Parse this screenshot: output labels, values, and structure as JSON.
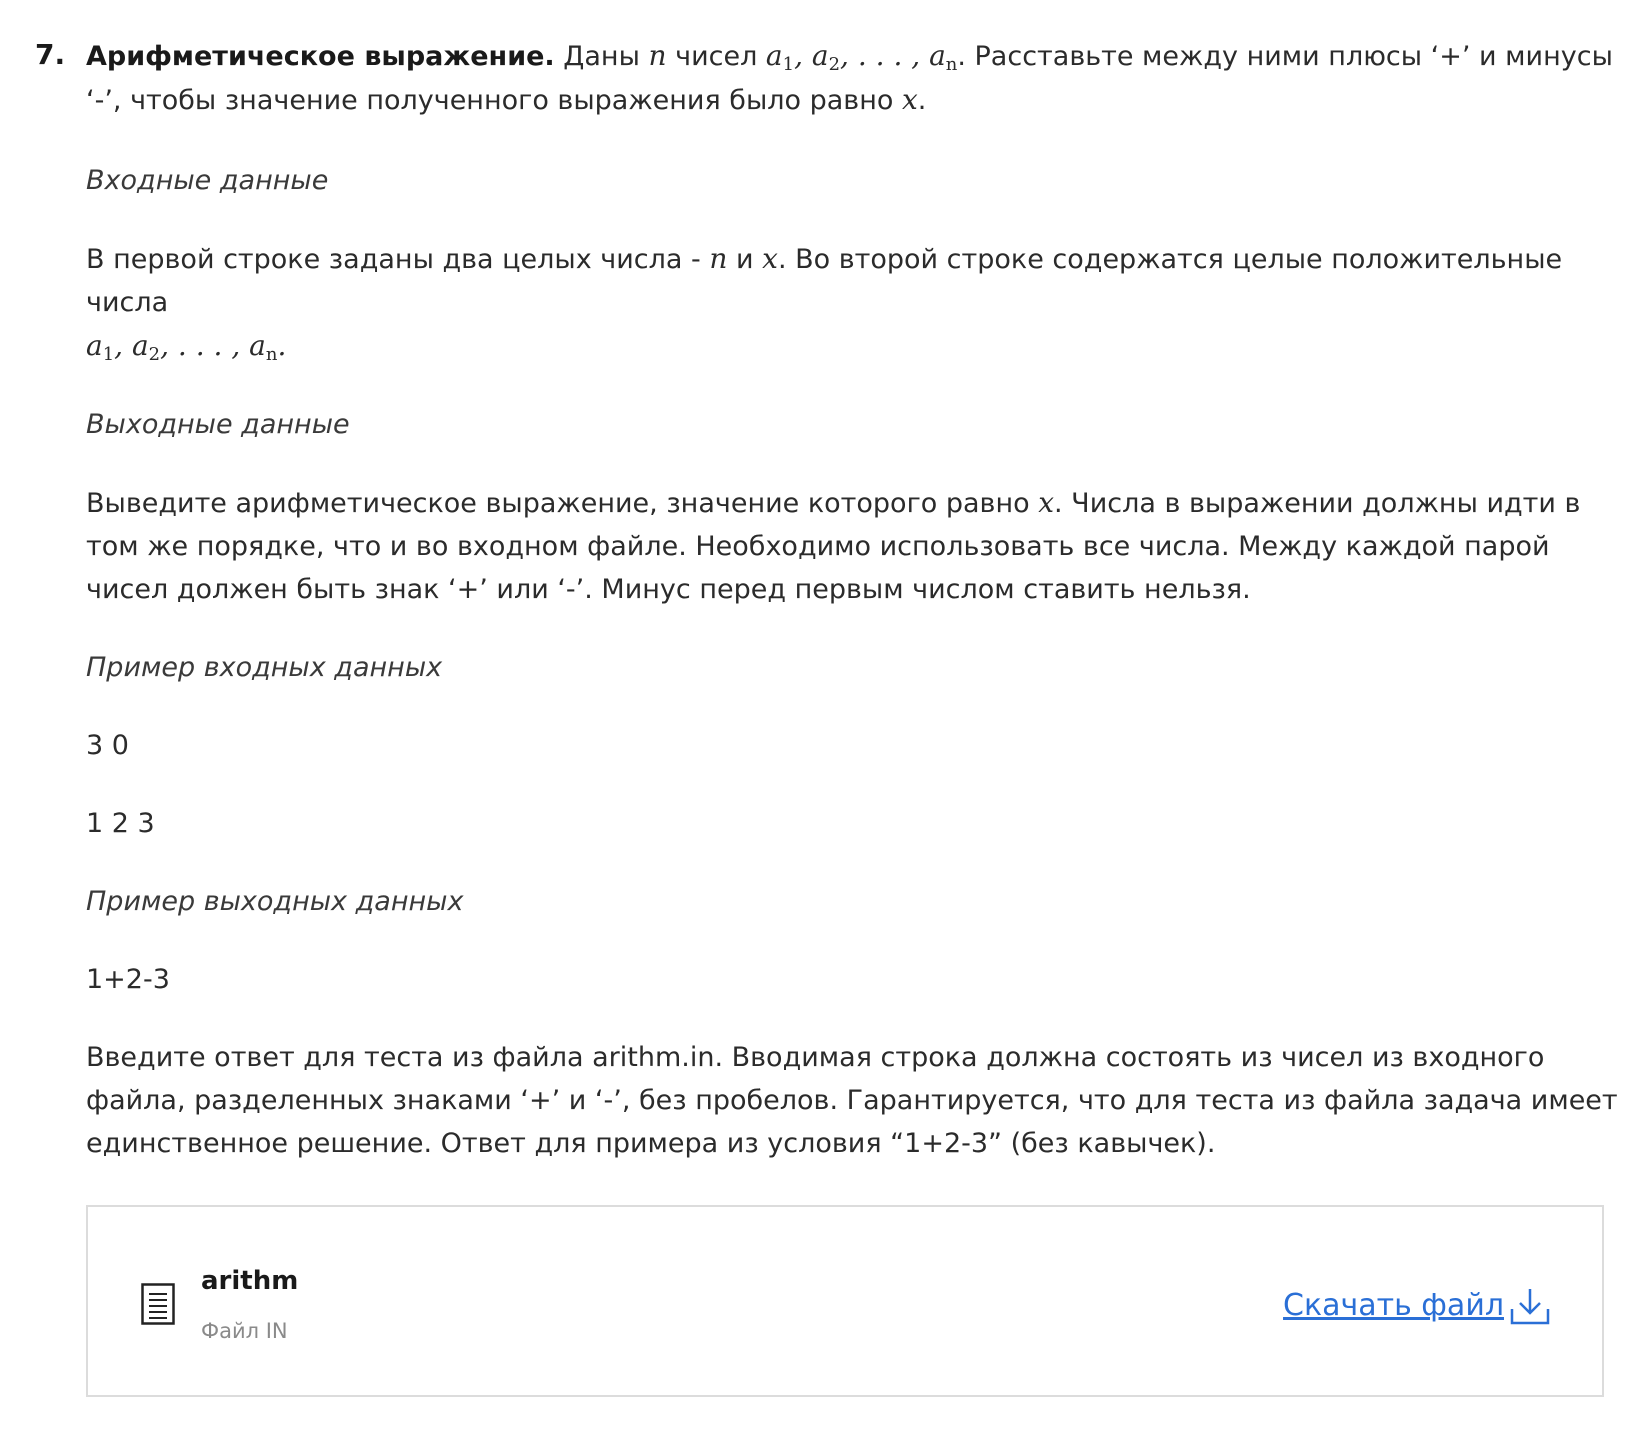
{
  "problem": {
    "number": "7.",
    "title": "Арифметическое выражение.",
    "statement": {
      "t1": " Даны ",
      "n": "n",
      "t2": " чисел ",
      "a": "a",
      "sub1": "1",
      "sub2": "2",
      "ellipsis": ", . . . , ",
      "subn": "n",
      "t3": ". Расставьте между ними плюсы ‘+’ и минусы ‘-’, чтобы значение полученного выражения было равно ",
      "x": "x",
      "t4": "."
    },
    "input_heading": "Входные данные",
    "input_text": {
      "t1": "В первой строке заданы два целых числа - ",
      "n": "n",
      "t2": " и ",
      "x": "x",
      "t3": ". Во второй строке содержатся целые положительные числа",
      "a": "a",
      "sub1": "1",
      "sub2": "2",
      "ellipsis": ", . . . , ",
      "subn": "n",
      "t4": "."
    },
    "output_heading": "Выходные данные",
    "output_text": {
      "t1": "Выведите арифметическое выражение, значение которого равно ",
      "x": "x",
      "t2": ". Числа в выражении должны идти в том же порядке, что и во входном файле. Необходимо использовать все числа. Между каждой парой чисел должен быть знак ‘+’ или ‘-’. Минус перед первым числом ставить нельзя."
    },
    "sample_input_heading": "Пример входных данных",
    "sample_input_line1": "3 0",
    "sample_input_line2": "1 2 3",
    "sample_output_heading": "Пример выходных данных",
    "sample_output": "1+2-3",
    "instructions": "Введите ответ для теста из файла arithm.in. Вводимая строка должна состоять из чисел из входного файла, разделенных знаками ‘+’ и ‘-’, без пробелов. Гарантируется, что для теста из файла задача имеет единственное решение. Ответ для примера из условия “1+2-3” (без кавычек)."
  },
  "attachment": {
    "name": "arithm",
    "type": "Файл IN",
    "download_label": "Скачать файл",
    "icon": "document-icon",
    "download_icon": "download-arrow-icon",
    "link_color": "#2a6fd6"
  }
}
